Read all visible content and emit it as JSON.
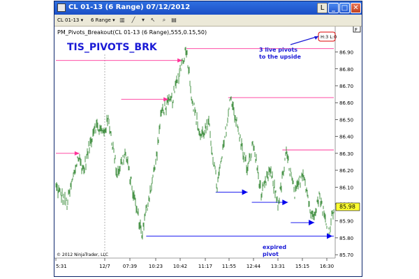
{
  "window": {
    "title": "CL 01-13 (6 Range)  07/12/2012",
    "buttons": {
      "lbl": "L",
      "minimize": "_",
      "maximize": "□",
      "close": "✕"
    }
  },
  "toolbar": {
    "instrument": "CL 01-13",
    "interval": "6 Range",
    "chevron": "▾",
    "icons": [
      "bar-type-icon",
      "draw-icon",
      "pointer-icon",
      "zoom-icon",
      "properties-icon"
    ]
  },
  "chart": {
    "indicator_label": "PM_Pivots_Breakout(CL 01-13 (6 Range),555,0.15,50)",
    "system_name": "TIS_PIVOTS_BRK",
    "count_box": "H:3 L:0",
    "f_button": "F",
    "current_price": "85.98",
    "copyright": "© 2012 NinjaTrader, LLC",
    "annotations": {
      "live_pivots": [
        "3 live pivots",
        "to the upside"
      ],
      "expired_pivot": [
        "expired",
        "pivot"
      ]
    },
    "colors": {
      "price": "#1d7a1d",
      "high_pivot": "#ff3399",
      "low_pivot": "#0000ee",
      "annotation_text": "#1a1ad6",
      "price_marker": "#ffff33"
    }
  },
  "chart_data": {
    "type": "bar",
    "y_ticks": [
      "86.90",
      "86.80",
      "86.70",
      "86.60",
      "86.50",
      "86.40",
      "86.30",
      "86.20",
      "86.10",
      "86.00",
      "85.90",
      "85.80",
      "85.70"
    ],
    "x_ticks": [
      "5:31",
      "12/7",
      "07:39",
      "10:23",
      "10:42",
      "11:17",
      "11:55",
      "12:44",
      "13:31",
      "15:15",
      "16:30"
    ],
    "ylim": [
      85.68,
      86.96
    ],
    "close_path": [
      {
        "x": 0,
        "y": 86.1
      },
      {
        "x": 0.04,
        "y": 86.0
      },
      {
        "x": 0.08,
        "y": 86.28
      },
      {
        "x": 0.1,
        "y": 86.2
      },
      {
        "x": 0.14,
        "y": 86.47
      },
      {
        "x": 0.17,
        "y": 86.42
      },
      {
        "x": 0.19,
        "y": 86.5
      },
      {
        "x": 0.22,
        "y": 86.18
      },
      {
        "x": 0.25,
        "y": 86.3
      },
      {
        "x": 0.28,
        "y": 86.05
      },
      {
        "x": 0.31,
        "y": 85.82
      },
      {
        "x": 0.33,
        "y": 86.0
      },
      {
        "x": 0.36,
        "y": 86.25
      },
      {
        "x": 0.38,
        "y": 86.55
      },
      {
        "x": 0.42,
        "y": 86.62
      },
      {
        "x": 0.45,
        "y": 86.82
      },
      {
        "x": 0.47,
        "y": 86.92
      },
      {
        "x": 0.49,
        "y": 86.62
      },
      {
        "x": 0.52,
        "y": 86.4
      },
      {
        "x": 0.55,
        "y": 86.47
      },
      {
        "x": 0.58,
        "y": 86.1
      },
      {
        "x": 0.6,
        "y": 86.3
      },
      {
        "x": 0.63,
        "y": 86.64
      },
      {
        "x": 0.66,
        "y": 86.4
      },
      {
        "x": 0.69,
        "y": 86.2
      },
      {
        "x": 0.71,
        "y": 86.36
      },
      {
        "x": 0.74,
        "y": 86.05
      },
      {
        "x": 0.77,
        "y": 86.2
      },
      {
        "x": 0.8,
        "y": 86.0
      },
      {
        "x": 0.83,
        "y": 86.3
      },
      {
        "x": 0.86,
        "y": 86.05
      },
      {
        "x": 0.89,
        "y": 86.2
      },
      {
        "x": 0.92,
        "y": 85.92
      },
      {
        "x": 0.95,
        "y": 86.05
      },
      {
        "x": 0.98,
        "y": 85.82
      },
      {
        "x": 1.0,
        "y": 85.98
      }
    ],
    "high_pivots": [
      {
        "price": 86.3,
        "x_start": 0.0,
        "x_end": 0.085
      },
      {
        "price": 86.62,
        "x_start": 0.235,
        "x_end": 0.405
      },
      {
        "price": 86.85,
        "x_start": 0.0,
        "x_end": 0.455
      },
      {
        "price": 86.92,
        "x_start": 0.47,
        "x_end": 1.0
      },
      {
        "price": 86.63,
        "x_start": 0.62,
        "x_end": 1.0
      },
      {
        "price": 86.32,
        "x_start": 0.815,
        "x_end": 1.0
      }
    ],
    "low_pivots": [
      {
        "price": 85.81,
        "x_start": 0.325,
        "x_end": 1.0
      },
      {
        "price": 86.07,
        "x_start": 0.575,
        "x_end": 0.69
      },
      {
        "price": 86.01,
        "x_start": 0.705,
        "x_end": 0.835
      },
      {
        "price": 85.89,
        "x_start": 0.845,
        "x_end": 0.93
      }
    ]
  }
}
